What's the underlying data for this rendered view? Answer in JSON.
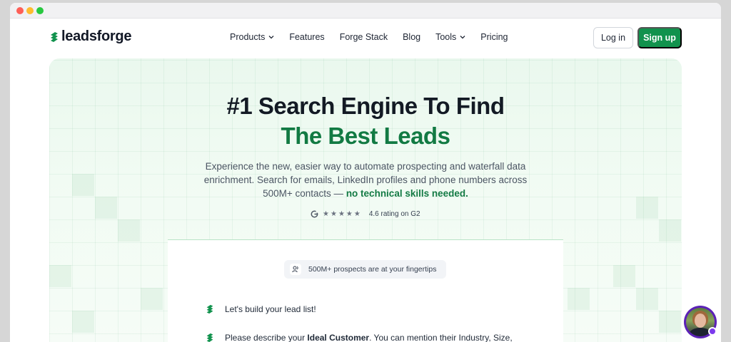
{
  "window": {
    "controls": [
      "close",
      "minimize",
      "maximize"
    ]
  },
  "brand": {
    "name": "leadsforge",
    "logo_icon": "leadsforge-logo-icon",
    "accent": "#11924d"
  },
  "nav": {
    "items": [
      {
        "label": "Products",
        "has_dropdown": true
      },
      {
        "label": "Features",
        "has_dropdown": false
      },
      {
        "label": "Forge Stack",
        "has_dropdown": false
      },
      {
        "label": "Blog",
        "has_dropdown": false
      },
      {
        "label": "Tools",
        "has_dropdown": true
      },
      {
        "label": "Pricing",
        "has_dropdown": false
      }
    ],
    "login_label": "Log in",
    "signup_label": "Sign up"
  },
  "hero": {
    "headline_line1": "#1 Search Engine To Find",
    "headline_line2": "The Best Leads",
    "subtext_main": "Experience the new, easier way to automate prospecting and waterfall data enrichment. Search for emails, LinkedIn profiles and phone numbers across 500M+ contacts — ",
    "subtext_emphasis": "no technical skills needed.",
    "rating_text": "4.6 rating on G2",
    "rating_stars": 5,
    "rating_icon": "g2-icon"
  },
  "chat_panel": {
    "badge_text": "500M+ prospects are at your fingertips",
    "badge_icon": "users-icon",
    "message1": "Let's build your lead list!",
    "message2_prefix": "Please describe your ",
    "message2_bold": "Ideal Customer",
    "message2_suffix": ". You can mention their Industry, Size,"
  },
  "support_avatar": {
    "icon": "support-avatar-icon"
  }
}
